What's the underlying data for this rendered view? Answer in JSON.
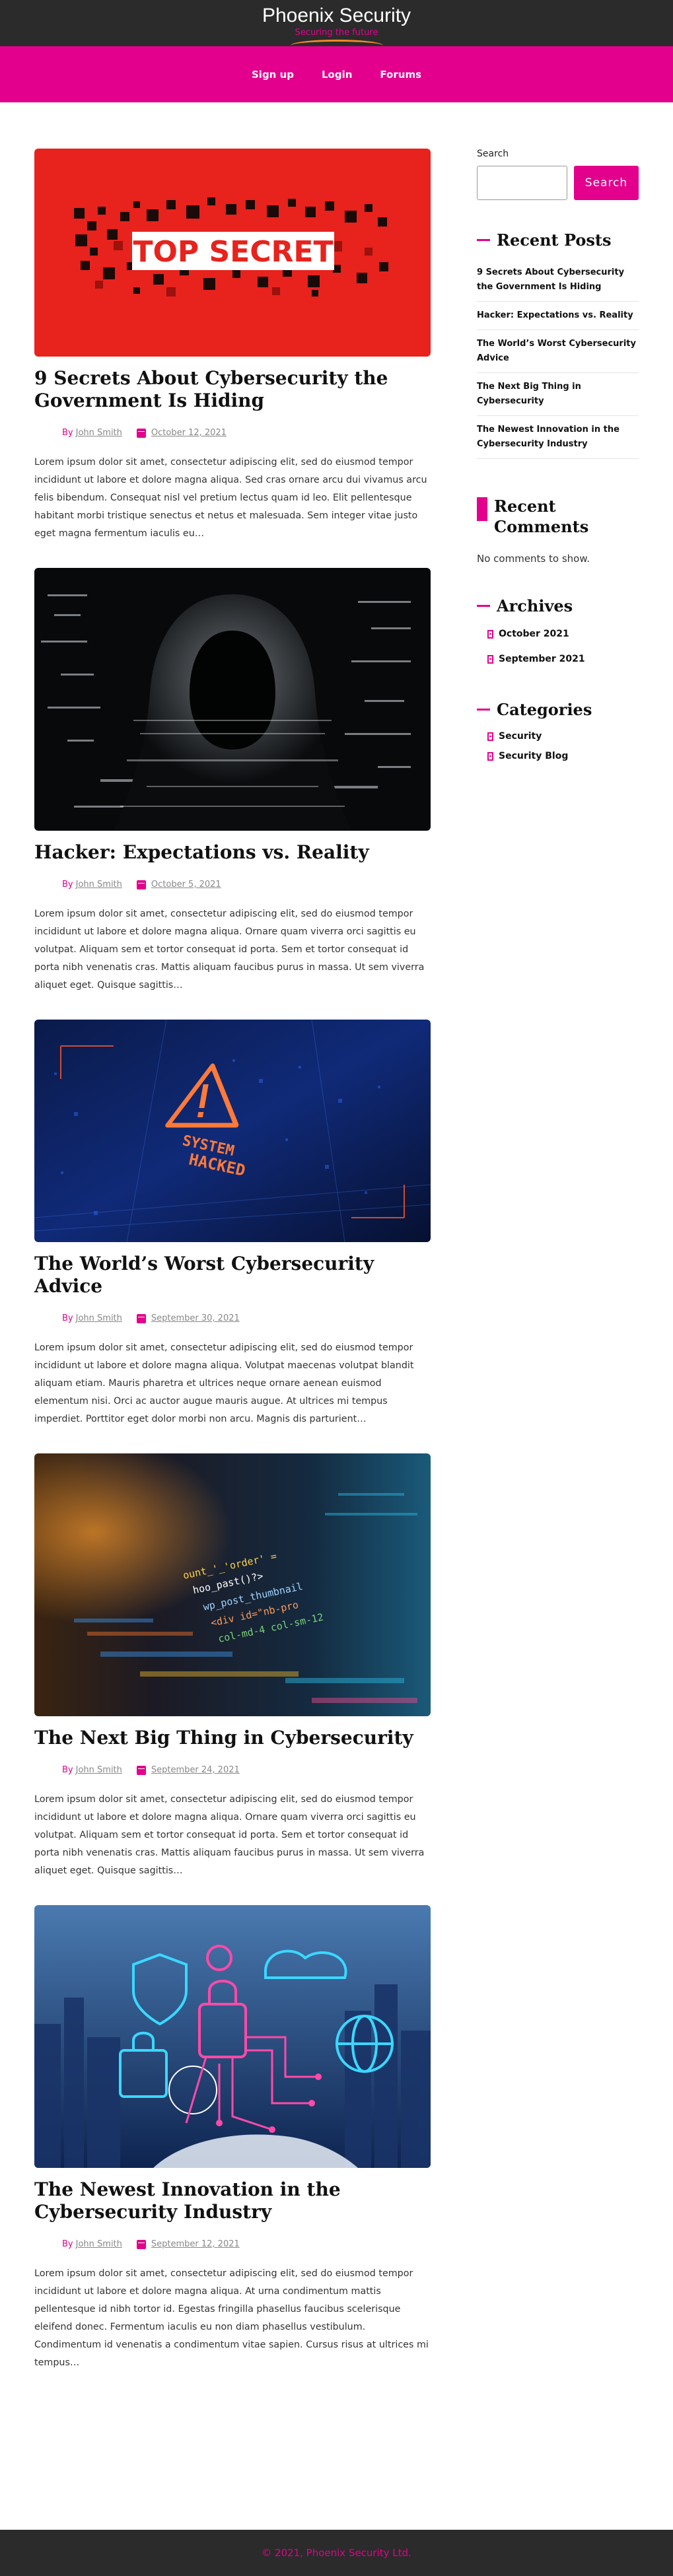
{
  "header": {
    "site_title": "Phoenix Security",
    "tagline": "Securing the future"
  },
  "nav": {
    "items": [
      "Sign up",
      "Login",
      "Forums"
    ]
  },
  "posts": [
    {
      "title": "9 Secrets About Cybersecurity the Government Is Hiding",
      "by": "By",
      "author": "John Smith",
      "date": "October 12, 2021",
      "excerpt": "Lorem ipsum dolor sit amet, consectetur adipiscing elit, sed do eiusmod tempor incididunt ut labore et dolore magna aliqua. Sed cras ornare arcu dui vivamus arcu felis bibendum. Consequat nisl vel pretium lectus quam id leo. Elit pellentesque habitant morbi tristique senectus et netus et malesuada. Sem integer vitae justo eget magna fermentum iaculis eu…",
      "image_text": "TOP SECRET"
    },
    {
      "title": "Hacker: Expectations vs. Reality",
      "by": "By",
      "author": "John Smith",
      "date": "October 5, 2021",
      "excerpt": "Lorem ipsum dolor sit amet, consectetur adipiscing elit, sed do eiusmod tempor incididunt ut labore et dolore magna aliqua. Ornare quam viverra orci sagittis eu volutpat. Aliquam sem et tortor consequat id porta. Sem et tortor consequat id porta nibh venenatis cras. Mattis aliquam faucibus purus in massa. Ut sem viverra aliquet eget. Quisque sagittis…"
    },
    {
      "title": "The World’s Worst Cybersecurity Advice",
      "by": "By",
      "author": "John Smith",
      "date": "September 30, 2021",
      "excerpt": "Lorem ipsum dolor sit amet, consectetur adipiscing elit, sed do eiusmod tempor incididunt ut labore et dolore magna aliqua. Volutpat maecenas volutpat blandit aliquam etiam. Mauris pharetra et ultrices neque ornare aenean euismod elementum nisi. Orci ac auctor augue mauris augue. At ultrices mi tempus imperdiet. Porttitor eget dolor morbi non arcu. Magnis dis parturient…",
      "image_text": [
        "SYSTEM",
        "HACKED"
      ]
    },
    {
      "title": "The Next Big Thing in Cybersecurity",
      "by": "By",
      "author": "John Smith",
      "date": "September 24, 2021",
      "excerpt": "Lorem ipsum dolor sit amet, consectetur adipiscing elit, sed do eiusmod tempor incididunt ut labore et dolore magna aliqua. Ornare quam viverra orci sagittis eu volutpat. Aliquam sem et tortor consequat id porta. Sem et tortor consequat id porta nibh venenatis cras. Mattis aliquam faucibus purus in massa. Ut sem viverra aliquet eget. Quisque sagittis…",
      "code_lines": [
        "ount_'_'order' =",
        "hoo_past()?>",
        "wp_post_thumbnail",
        "<div id=\"nb-pro",
        "col-md-4 col-sm-12"
      ]
    },
    {
      "title": "The Newest Innovation in the Cybersecurity Industry",
      "by": "By",
      "author": "John Smith",
      "date": "September 12, 2021",
      "excerpt": "Lorem ipsum dolor sit amet, consectetur adipiscing elit, sed do eiusmod tempor incididunt ut labore et dolore magna aliqua. At urna condimentum mattis pellentesque id nibh tortor id. Egestas fringilla phasellus faucibus scelerisque eleifend donec. Fermentum iaculis eu non diam phasellus vestibulum. Condimentum id venenatis a condimentum vitae sapien. Cursus risus at ultrices mi tempus…"
    }
  ],
  "sidebar": {
    "search": {
      "label": "Search",
      "placeholder": "",
      "button": "Search"
    },
    "recent_posts": {
      "title": "Recent Posts",
      "items": [
        "9 Secrets About Cybersecurity the Government Is Hiding",
        "Hacker: Expectations vs. Reality",
        "The World’s Worst Cybersecurity Advice",
        "The Next Big Thing in Cybersecurity",
        "The Newest Innovation in the Cybersecurity Industry"
      ]
    },
    "recent_comments": {
      "title_line1": "Recent",
      "title_line2": "Comments",
      "empty": "No comments to show."
    },
    "archives": {
      "title": "Archives",
      "items": [
        "October 2021",
        "September 2021"
      ]
    },
    "categories": {
      "title": "Categories",
      "items": [
        "Security",
        "Security Blog"
      ]
    }
  },
  "footer": {
    "text": "© 2021, Phoenix Security Ltd."
  },
  "colors": {
    "accent": "#e3008c",
    "dark": "#2b2b2b"
  }
}
